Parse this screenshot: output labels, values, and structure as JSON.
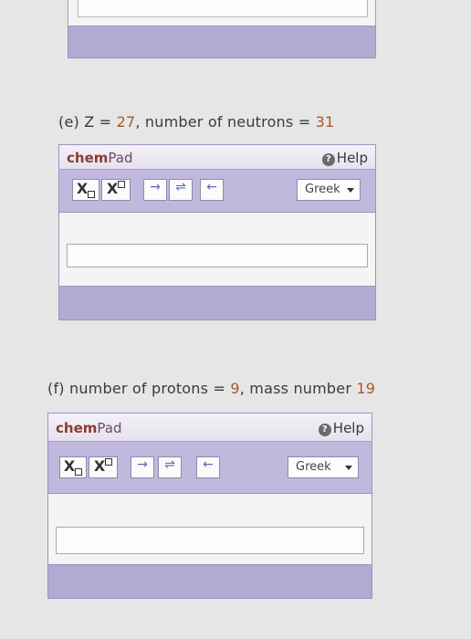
{
  "question_e": {
    "prefix": "(e) Z = ",
    "z_value": "27",
    "middle": ", number of neutrons = ",
    "neutrons_value": "31"
  },
  "question_f": {
    "prefix": "(f) number of protons = ",
    "protons_value": "9",
    "middle": ", mass number ",
    "mass_value": "19"
  },
  "chempad": {
    "title_chem": "chem",
    "title_pad": "Pad",
    "help_label": "Help",
    "help_icon": "?",
    "subscript_label": "X",
    "superscript_label": "X",
    "arrow_right": "→",
    "arrow_equilibrium": "⇌",
    "arrow_left": "←",
    "greek_label": "Greek"
  },
  "colors": {
    "toolbar_bg": "#c1b9dd",
    "footer_bg": "#b3aad3",
    "title_color": "#8a3c30",
    "number_color": "#a8582a"
  }
}
